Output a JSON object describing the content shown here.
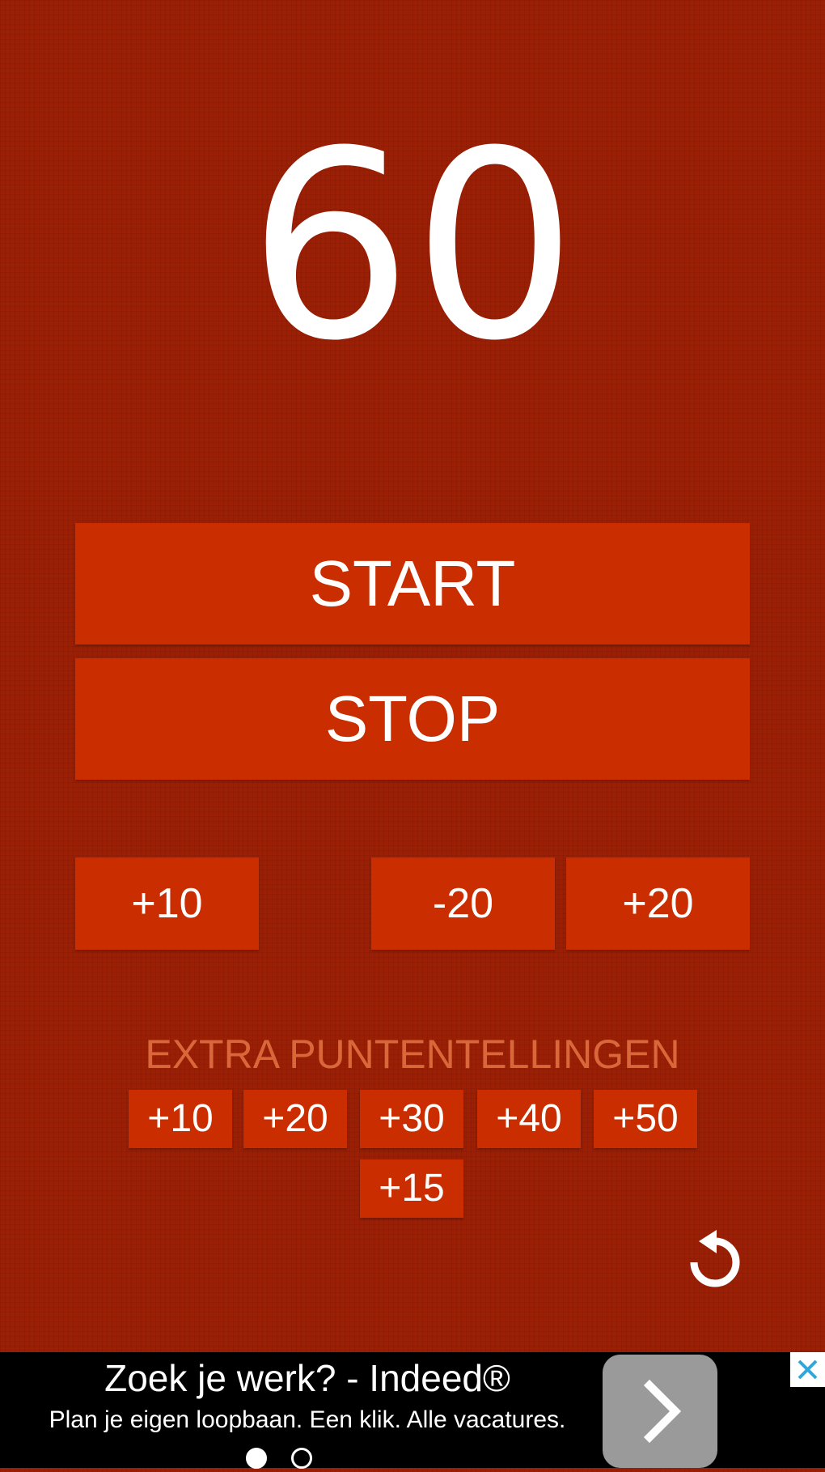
{
  "score": "60",
  "controls": {
    "start_label": "START",
    "stop_label": "STOP"
  },
  "adjust_buttons": [
    {
      "label": "+10"
    },
    {
      "label": "-20"
    },
    {
      "label": "+20"
    }
  ],
  "extra_scores": {
    "title": "EXTRA PUNTENTELLINGEN",
    "buttons": [
      {
        "label": "+10"
      },
      {
        "label": "+20"
      },
      {
        "label": "+30"
      },
      {
        "label": "+40"
      },
      {
        "label": "+50"
      },
      {
        "label": "+15"
      }
    ]
  },
  "icons": {
    "reset": "reset-icon",
    "ad_arrow": "chevron-right-icon",
    "ad_close": "close-icon"
  },
  "ad": {
    "title": "Zoek je werk? - Indeed®",
    "text": "Plan je eigen loopbaan. Een klik. Alle vacatures.",
    "pages": 2,
    "active_page": 1
  },
  "colors": {
    "background": "#9c1f04",
    "button": "#c92d00",
    "extra_label": "#d9673a",
    "close_icon": "#29a9e0"
  }
}
